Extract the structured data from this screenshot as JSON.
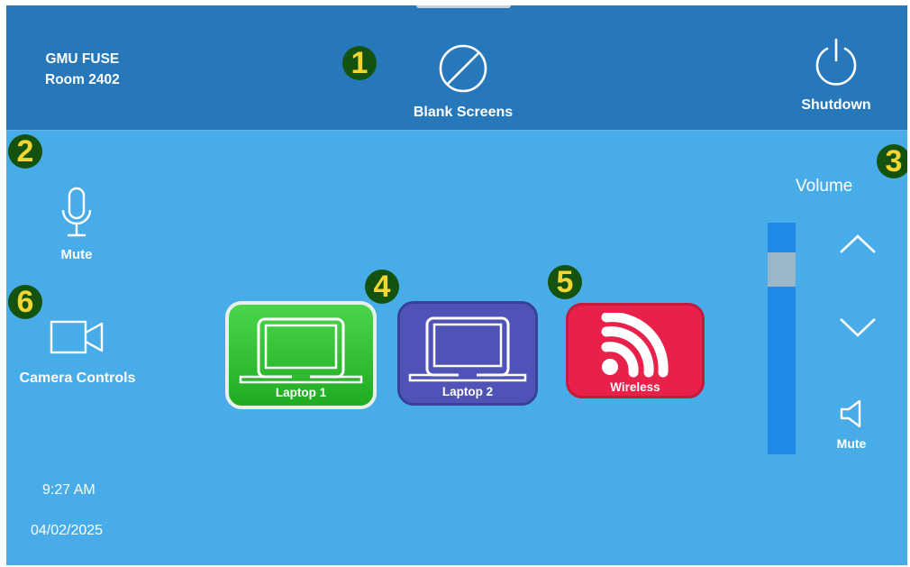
{
  "header": {
    "room_line1": "GMU FUSE",
    "room_line2": "Room 2402",
    "blank_screens_label": "Blank Screens",
    "shutdown_label": "Shutdown"
  },
  "badges": [
    "1",
    "2",
    "3",
    "4",
    "5",
    "6"
  ],
  "left_panel": {
    "mic_mute_label": "Mute",
    "camera_label": "Camera Controls",
    "time": "9:27 AM",
    "date": "04/02/2025"
  },
  "sources": [
    {
      "label": "Laptop 1",
      "color": "#2fbe33",
      "icon": "laptop-icon",
      "state": "selected"
    },
    {
      "label": "Laptop 2",
      "color": "#4f53b8",
      "icon": "laptop-icon"
    },
    {
      "label": "Wireless",
      "color": "#e8214a",
      "icon": "wifi-icon"
    }
  ],
  "volume": {
    "label": "Volume",
    "mute_label": "Mute",
    "level_percent": 85
  },
  "colors": {
    "header_bg": "#2678ba",
    "body_bg": "#48ace8",
    "volume_bar": "#1f8be7",
    "badge_bg": "#13530f",
    "badge_text": "#f3d634"
  }
}
